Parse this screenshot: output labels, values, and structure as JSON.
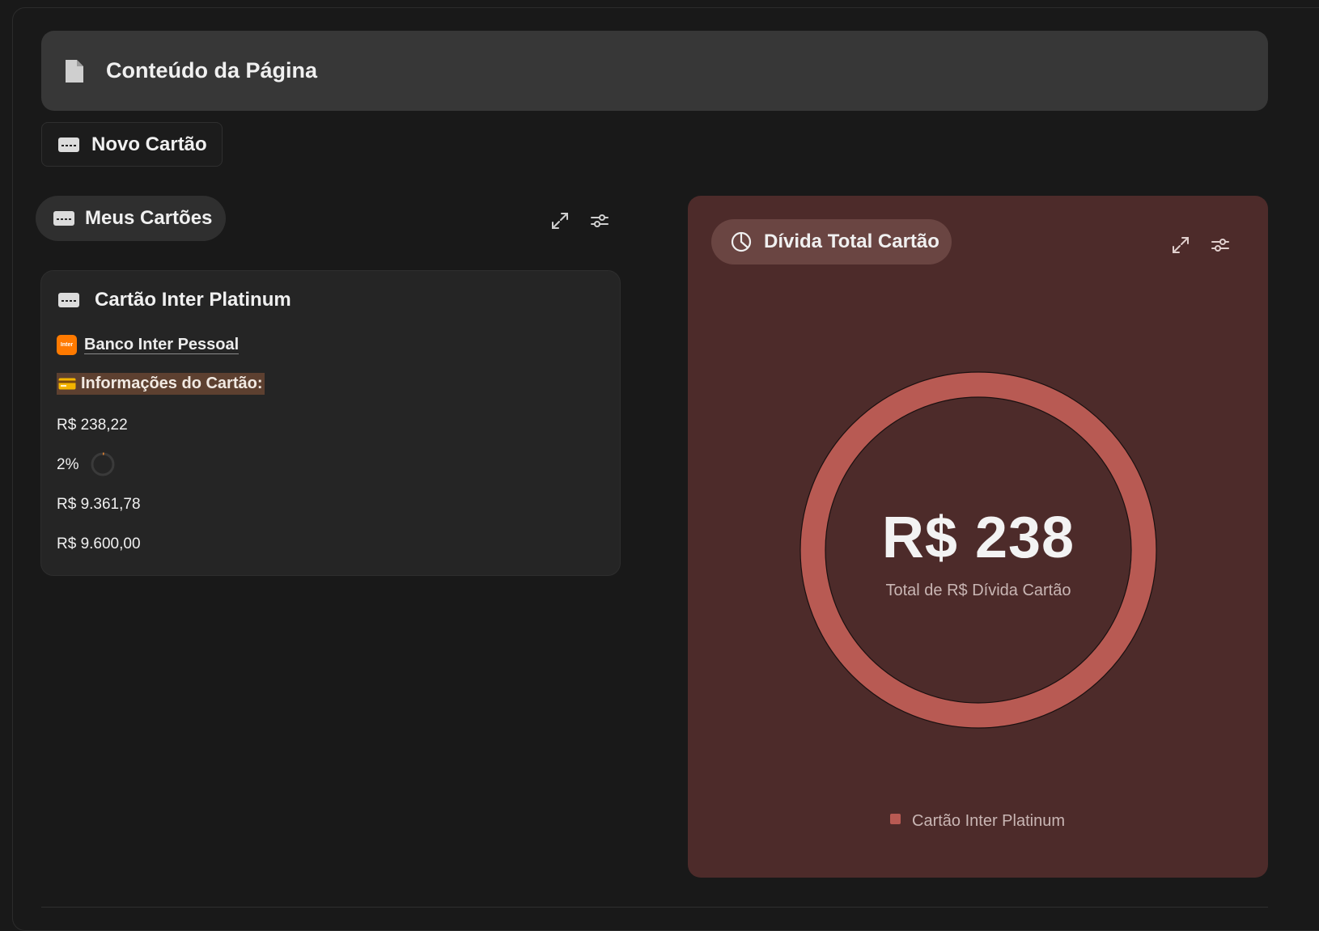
{
  "page": {
    "title": "Conteúdo da Página"
  },
  "toolbar": {
    "new_card_label": "Novo Cartão"
  },
  "cards_section": {
    "pill_label": "Meus Cartões",
    "card": {
      "title": "Cartão Inter Platinum",
      "bank_logo_text": "Inter",
      "bank_name": "Banco Inter Pessoal",
      "info_label": "Informações do Cartão:",
      "used_amount": "R$ 238,22",
      "usage_percent_label": "2%",
      "usage_fraction": 0.02,
      "available_amount": "R$ 9.361,78",
      "limit_amount": "R$ 9.600,00"
    }
  },
  "debt_panel": {
    "pill_label": "Dívida Total Cartão",
    "donut_value": "R$ 238",
    "donut_caption": "Total de R$ Dívida Cartão",
    "legend_label": "Cartão Inter Platinum"
  },
  "colors": {
    "background": "#191919",
    "header_bg": "#373737",
    "debt_panel_bg": "#4d2b2a",
    "donut_ring": "#b85a53",
    "bank_brand": "#ff7a00",
    "info_highlight": "#5d4030"
  },
  "chart_data": {
    "type": "pie",
    "categories": [
      "Cartão Inter Platinum"
    ],
    "values": [
      238.22
    ]
  }
}
